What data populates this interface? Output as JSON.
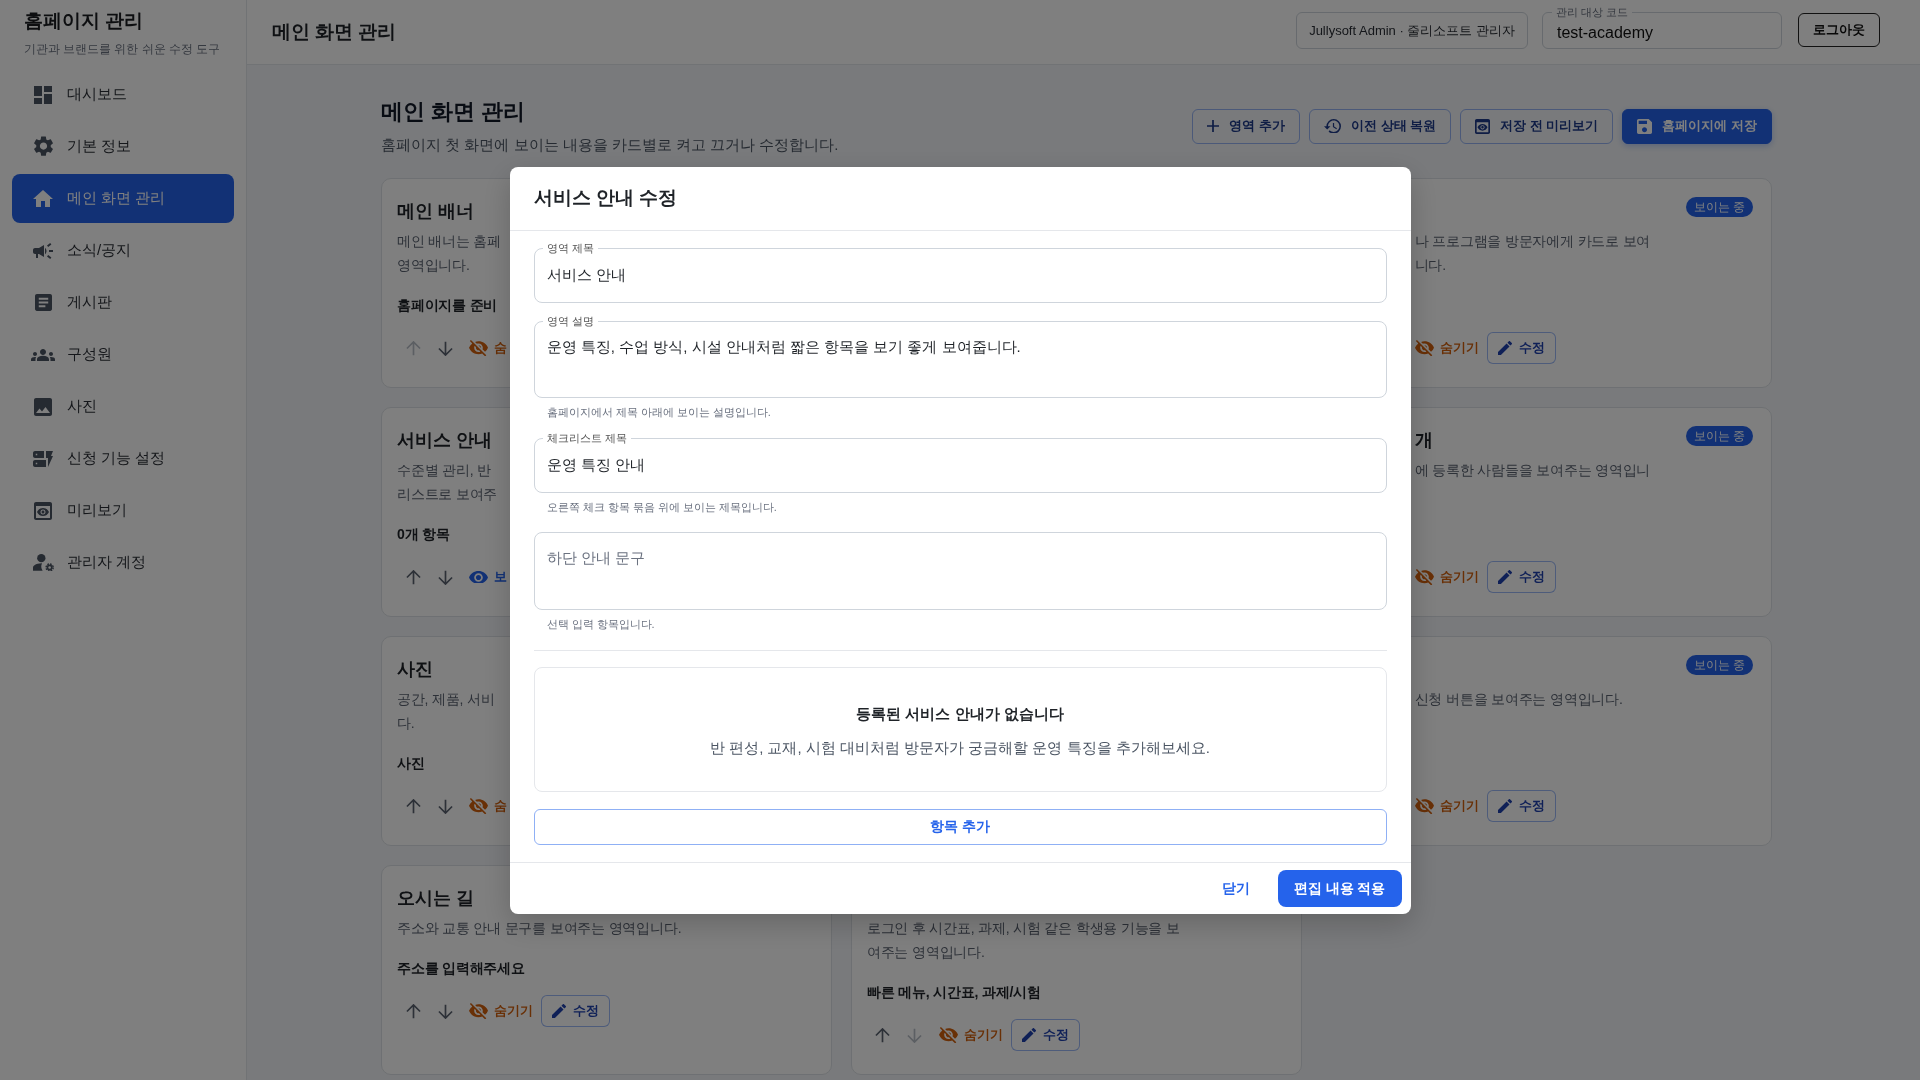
{
  "sidebar": {
    "title": "홈페이지 관리",
    "subtitle": "기관과 브랜드를 위한 쉬운 수정 도구",
    "items": [
      {
        "label": "대시보드",
        "selected": false
      },
      {
        "label": "기본 정보",
        "selected": false
      },
      {
        "label": "메인 화면 관리",
        "selected": true
      },
      {
        "label": "소식/공지",
        "selected": false
      },
      {
        "label": "게시판",
        "selected": false
      },
      {
        "label": "구성원",
        "selected": false
      },
      {
        "label": "사진",
        "selected": false
      },
      {
        "label": "신청 기능 설정",
        "selected": false
      },
      {
        "label": "미리보기",
        "selected": false
      },
      {
        "label": "관리자 계정",
        "selected": false
      }
    ]
  },
  "top_bar": {
    "title": "메인 화면 관리",
    "account": "Jullysoft Admin · 줄리소프트 관리자",
    "code_field": {
      "label": "관리 대상 코드",
      "value": "test-academy"
    },
    "logout": "로그아웃"
  },
  "page_header": {
    "title": "메인 화면 관리",
    "subtitle": "홈페이지 첫 화면에 보이는 내용을 카드별로 켜고 끄거나 수정합니다.",
    "actions": [
      {
        "label": "영역 추가",
        "kind": "outline"
      },
      {
        "label": "이전 상태 복원",
        "kind": "outline"
      },
      {
        "label": "저장 전 미리보기",
        "kind": "outline"
      },
      {
        "label": "홈페이지에 저장",
        "kind": "primary"
      }
    ]
  },
  "columns": [
    {
      "cards": [
        {
          "title": "메인 배너",
          "description_lines": [
            "메인 배너는 홈페",
            "영역입니다."
          ],
          "summary": "홈페이지를 준비",
          "move": {
            "up_disabled": true,
            "down_disabled": false
          },
          "visible": true,
          "toggle_label": "숨"
        },
        {
          "title": "서비스 안내",
          "description_lines": [
            "수준별 관리, 반",
            "리스트로 보여주"
          ],
          "summary": "0개 항목",
          "move": {
            "up_disabled": false,
            "down_disabled": false
          },
          "visible": false,
          "toggle_label": "보"
        },
        {
          "title": "사진",
          "description_lines": [
            "공간, 제품, 서비",
            "다."
          ],
          "summary": "사진",
          "move": {
            "up_disabled": false,
            "down_disabled": false
          },
          "visible": true,
          "toggle_label": "숨"
        },
        {
          "title": "오시는 길",
          "description_lines": [
            "주소와 교통 안내 문구를 보여주는 영역입니다."
          ],
          "summary": "주소를 입력해주세요",
          "move": {
            "up_disabled": false,
            "down_disabled": false
          },
          "visible": true,
          "toggle_label": "숨기기",
          "edit_label": "수정"
        }
      ]
    },
    {
      "cards": [
        {
          "description_lines": [
            "로그인 후 시간표, 과제, 시험 같은 학생용 기능을 보",
            "여주는 영역입니다."
          ],
          "summary": "빠른 메뉴, 시간표, 과제/시험",
          "move": {
            "up_disabled": false,
            "down_disabled": true
          },
          "visible": true,
          "toggle_label": "숨기기",
          "edit_label": "수정"
        }
      ]
    },
    {
      "cards": [
        {
          "badge": "보이는 중",
          "description_lines": [
            "나 프로그램을 방문자에게 카드로 보여",
            "니다."
          ],
          "visible": true,
          "toggle_label": "숨기기",
          "edit_label": "수정"
        },
        {
          "title": "개",
          "badge": "보이는 중",
          "description_lines": [
            "에 등록한 사람들을 보여주는 영역입니"
          ],
          "visible": true,
          "toggle_label": "숨기기",
          "edit_label": "수정"
        },
        {
          "badge": "보이는 중",
          "description_lines": [
            "신청 버튼을 보여주는 영역입니다."
          ],
          "visible": true,
          "toggle_label": "숨기기",
          "edit_label": "수정"
        }
      ]
    }
  ],
  "modal": {
    "title": "서비스 안내 수정",
    "fields": [
      {
        "kind": "input",
        "label": "영역 제목",
        "value": "서비스 안내"
      },
      {
        "kind": "textarea",
        "label": "영역 설명",
        "value": "운영 특징, 수업 방식, 시설 안내처럼 짧은 항목을 보기 좋게 보여줍니다.",
        "help": "홈페이지에서 제목 아래에 보이는 설명입니다."
      },
      {
        "kind": "input",
        "label": "체크리스트 제목",
        "value": "운영 특징 안내",
        "help": "오른쪽 체크 항목 묶음 위에 보이는 제목입니다."
      },
      {
        "kind": "textarea",
        "placeholder": "하단 안내 문구",
        "help": "선택 입력 항목입니다."
      }
    ],
    "empty_state": {
      "title": "등록된 서비스 안내가 없습니다",
      "text": "반 편성, 교재, 시험 대비처럼 방문자가 궁금해할 운영 특징을 추가해보세요."
    },
    "add_button": "항목 추가",
    "footer_buttons": [
      {
        "label": "닫기",
        "kind": "link"
      },
      {
        "label": "편집 내용 적용",
        "kind": "primary"
      }
    ]
  }
}
